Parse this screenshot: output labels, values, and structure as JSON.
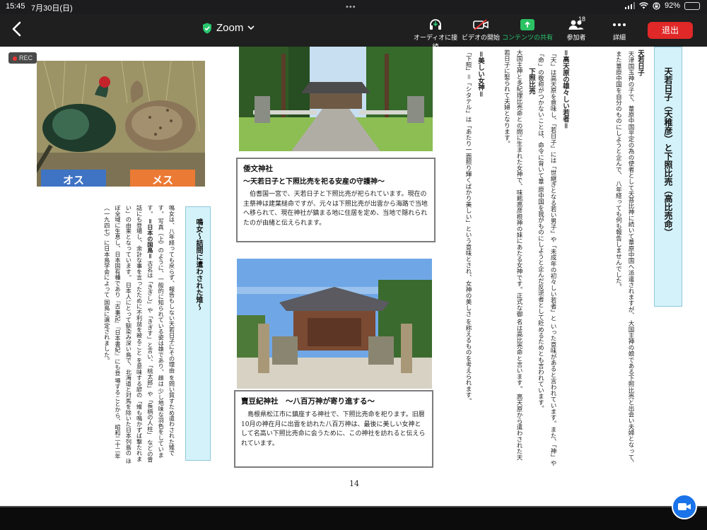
{
  "status_bar": {
    "time": "15:45",
    "date": "7月30日(日)",
    "grabber": "•••",
    "battery_percent": "92%",
    "battery_level": 0.92
  },
  "toolbar": {
    "title": "Zoom",
    "audio_label": "オーディオに接続",
    "video_label": "ビデオの開始",
    "share_label": "コンテンツの共有",
    "participants_label": "参加者",
    "participants_count": "18",
    "more_label": "詳細",
    "leave_label": "退出"
  },
  "recording": {
    "label": "REC"
  },
  "colors": {
    "share_green": "#2bc264",
    "leave_red": "#e02828",
    "heading_bg": "#d4f2fa",
    "zoom_blue": "#1a73e8"
  },
  "document": {
    "page_number": "14",
    "birds": {
      "male_label": "オス",
      "female_label": "メス"
    },
    "heading_main": {
      "line1": "天若日子（天稚彦）と",
      "line2": "下照比売（高比売命）"
    },
    "section_tenwaka": {
      "title": "天若日子",
      "text": [
        "天津国玉神の子で、葦原中国平定の為の使者として天菩比神に続いて葦原中国へ派遣されますが、",
        "大国主神の娘である下照比売と出会い夫婦となって、また葦原中国を自分のものにしようと企んで、",
        "八年経っても何も報告しませんでした。"
      ]
    },
    "section_heaven": {
      "heading": "＝高天原の雄々しい若者＝",
      "text": [
        "「天」は高天原を意味し、「若日子」には「世継ぎとなる若い男子」や「未成年の初々しい若者」と",
        "いった意味があると言われています。また、「神」や「命」の敬称がつかないことは、命令に背いて葦",
        "原中国を我がものにしようと企んだ反逆者として貶めるためとも言われています。"
      ]
    },
    "section_shitateru": {
      "title": "下照比売",
      "text": [
        "大国主神と多紀理比売命との間に生まれた女神で、味耜高彦根神の妹にあたる女神です。正式な御",
        "名は高比売命と言います。",
        "高天原から遣わされた天若日子に娶られて夫婦となります。"
      ]
    },
    "section_beauty": {
      "heading": "＝美しい女神＝",
      "text": [
        "「下照」＝「シタテル」は「あたり一面照り輝くばかり美しい」という意味とされ、女神の美しさ",
        "を称えるものを考えられます。"
      ]
    },
    "caption_shitori": {
      "title": "倭文神社",
      "subtitle": "～天若日子と下照比売を祀る安産の守護神～",
      "body": "伯耆国一宮で、天若日子と下照比売が祀られています。現在の主祭神は建葉槌命ですが、元々は下照比売が出雲から海路で当地へ移られて、現在神社が鎮まる地に住居を定め、当地で隠れられたのが由緒と伝えられます。"
    },
    "caption_kaneki": {
      "title": "賣豆紀神社　～八百万神が寄り進する～",
      "body": "島根県松江市に鎮座する神社で、下照比売命を祀ります。旧暦10月の神在月に出雲を訪れた八百万神は、最後に美しい女神として名高い下照比売命に会うために、この神社を訪れると伝えられています。"
    },
    "naki_me": {
      "heading": "鳴女",
      "subheading": "～詰問に遣わされた雉～",
      "text": [
        "鳴女は、八年経っても戻らず、報告もしない天若日子にその理由",
        "を問い質すため遣わされた雉です。",
        "写真（上）のように、一般的に知られている姿は雄であり、雌は",
        "少し地味な羽色をしています。",
        "＝日本の国鳥＝",
        "古名は「きぎし」や「きぎす」と言い、「桃太郎」や「長柄の人柱」",
        "などの昔話にも登場し、余計な事を言ったために不利益を被ること",
        "を意味する諺の「雉も鳴かずば撃たれまい」の由来となっています。",
        "日本人にとって馴染み深い鳥で、北海道と対馬を除いた日本列島の",
        "ほぼ全域に生息し、日本固有種であり『古事記』『日本書紀』にも登",
        "場することから、昭和二十二年（一九四七）に日本鳥学会によって",
        "国鳥に選定されました。"
      ]
    }
  }
}
